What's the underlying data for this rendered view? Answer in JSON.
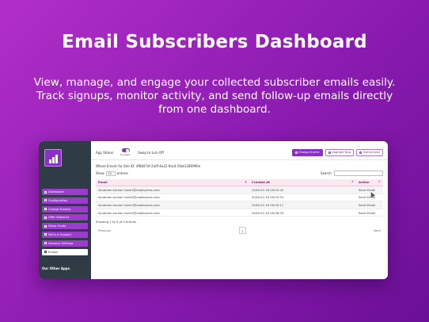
{
  "hero": {
    "title": "Email Subscribers Dashboard",
    "subtitle": "View, manage, and engage your collected subscriber emails easily. Track signups, monitor activity, and send follow-up emails directly from one dashboard."
  },
  "colors": {
    "accent": "#8b2fc9",
    "sidebar": "#2f3b45",
    "table_header": "#fbe9f1"
  },
  "sidebar": {
    "items": [
      {
        "label": "Dashboard",
        "icon": "dashboard-icon"
      },
      {
        "label": "Configuration",
        "icon": "gear-icon"
      },
      {
        "label": "Change themes",
        "icon": "brush-icon"
      },
      {
        "label": "Offer Statistics",
        "icon": "chart-icon"
      },
      {
        "label": "Setup Guide",
        "icon": "book-icon"
      },
      {
        "label": "FAQ's & Support",
        "icon": "question-icon"
      },
      {
        "label": "Advance Settings",
        "icon": "sliders-icon"
      },
      {
        "label": "Emails",
        "icon": "mail-icon"
      }
    ],
    "other_apps": "Our Other Apps"
  },
  "topbar": {
    "app_status_label": "App Status:",
    "toggle_state": "Enabled",
    "swap_text": "Swap to turn Off",
    "change_theme": "Change theme",
    "upgrade_now": "Upgrade Now",
    "instructions": "Instructions"
  },
  "site": {
    "line": "Wheel Emails for Site ID: 4f8847af-2a0f-4e22-9ac4-5fab1286990e"
  },
  "controls": {
    "show": "Show",
    "entries_value": "10",
    "entries": "entries",
    "search_label": "Search:"
  },
  "table": {
    "headers": [
      "Email",
      "Created At",
      "Action"
    ],
    "rows": [
      {
        "email": "shubham.kumar+wee1@makkpress.com",
        "created": "2026-02-16 09:02:43",
        "action": "Send Email"
      },
      {
        "email": "shubham.kumar+wee2@makkpress.com",
        "created": "2026-02-16 09:03:31",
        "action": "Send Email"
      },
      {
        "email": "shubham.kumar+wee1@makkpress.com",
        "created": "2026-02-16 09:05:11",
        "action": "Send Email"
      },
      {
        "email": "shubham.kumar+wee2@makkpress.com",
        "created": "2026-02-16 09:06:03",
        "action": "Send Email"
      }
    ]
  },
  "footer": {
    "info": "Showing 1 to 4 of 4 entries",
    "previous": "Previous",
    "page": "1",
    "next": "Next"
  }
}
